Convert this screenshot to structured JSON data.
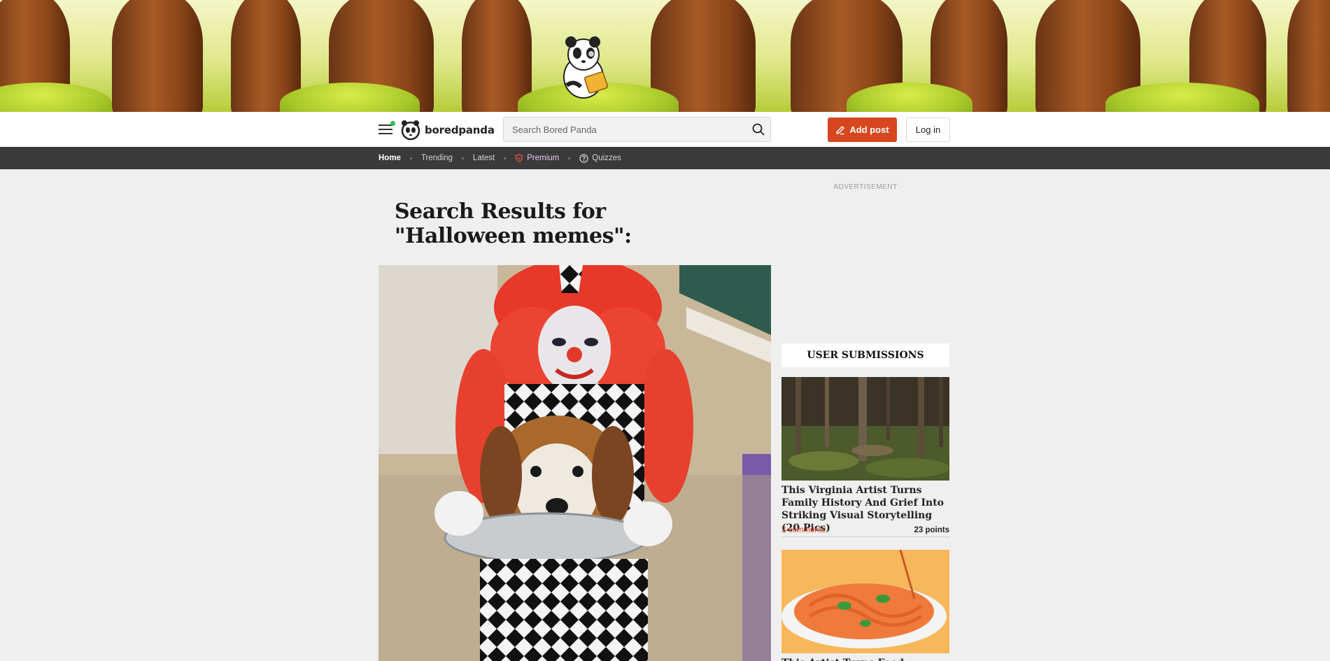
{
  "header": {
    "logo_text": "boredpanda",
    "search_placeholder": "Search Bored Panda",
    "add_post_label": "Add post",
    "login_label": "Log in"
  },
  "nav": {
    "items": [
      {
        "label": "Home",
        "active": true
      },
      {
        "label": "Trending"
      },
      {
        "label": "Latest"
      },
      {
        "label": "Premium",
        "icon": "shield-icon"
      },
      {
        "label": "Quizzes",
        "icon": "question-circle-icon"
      }
    ]
  },
  "main": {
    "title": "Search Results for \"Halloween memes\":",
    "image_alt": "Beagle dressed in clown costume"
  },
  "sidebar": {
    "ad_label": "ADVERTISEMENT",
    "section_title": "USER SUBMISSIONS",
    "cards": [
      {
        "title": "This Virginia Artist Turns Family History And Grief Into Striking Visual Storytelling (20 Pics)",
        "comments": "3 comments",
        "points": "23 points"
      },
      {
        "title": "This Artist Turns Food..."
      }
    ]
  },
  "colors": {
    "accent": "#d8461f",
    "nav_bg": "#3a3a3a",
    "page_bg": "#efefef"
  }
}
